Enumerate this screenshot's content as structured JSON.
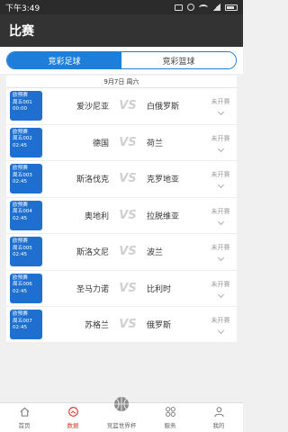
{
  "status_bar": {
    "time": "下午3:49"
  },
  "title": "比赛",
  "tabs": [
    {
      "label": "竞彩足球",
      "active": true
    },
    {
      "label": "竞彩篮球",
      "active": false
    }
  ],
  "date_header": "9月7日 周六",
  "vs_label": "VS",
  "matches": [
    {
      "league": "欧预赛",
      "code": "周五001",
      "time": "00:00",
      "home": "爱沙尼亚",
      "away": "白俄罗斯",
      "status": "未开赛"
    },
    {
      "league": "欧预赛",
      "code": "周五002",
      "time": "02:45",
      "home": "德国",
      "away": "荷兰",
      "status": "未开赛"
    },
    {
      "league": "欧预赛",
      "code": "周五003",
      "time": "02:45",
      "home": "斯洛伐克",
      "away": "克罗地亚",
      "status": "未开赛"
    },
    {
      "league": "欧预赛",
      "code": "周五004",
      "time": "02:45",
      "home": "奥地利",
      "away": "拉脱维亚",
      "status": "未开赛"
    },
    {
      "league": "欧预赛",
      "code": "周五005",
      "time": "02:45",
      "home": "斯洛文尼",
      "away": "波兰",
      "status": "未开赛"
    },
    {
      "league": "欧预赛",
      "code": "周五006",
      "time": "02:45",
      "home": "圣马力诺",
      "away": "比利时",
      "status": "未开赛"
    },
    {
      "league": "欧预赛",
      "code": "周五007",
      "time": "02:45",
      "home": "苏格兰",
      "away": "俄罗斯",
      "status": "未开赛"
    }
  ],
  "bottom_nav": [
    {
      "label": "首页",
      "icon": "home-icon",
      "active": false
    },
    {
      "label": "数据",
      "icon": "data-icon",
      "active": true
    },
    {
      "label": "竞篮世界杯",
      "icon": "basketball-icon",
      "active": false
    },
    {
      "label": "服务",
      "icon": "grid-icon",
      "active": false
    },
    {
      "label": "我的",
      "icon": "user-icon",
      "active": false
    }
  ],
  "colors": {
    "accent": "#1e7ed8",
    "badge": "#1e6fd0",
    "nav_active": "#d9362b",
    "titlebar": "#333333"
  }
}
